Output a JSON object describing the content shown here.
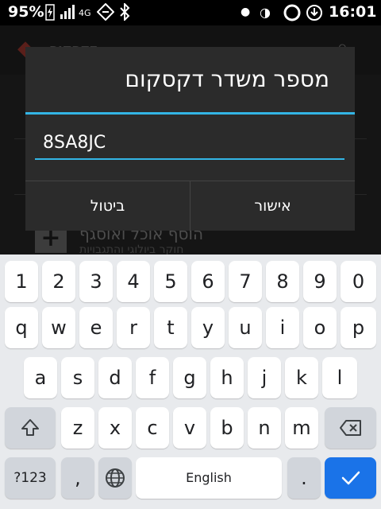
{
  "status_bar": {
    "battery": "95%",
    "network": "4G",
    "time": "16:01"
  },
  "dialog": {
    "title": "מספר משדר דקסקום",
    "input_value": "8SA8JC",
    "cancel_label": "ביטול",
    "ok_label": "אישור"
  },
  "background": {
    "app_title": "דקסקום",
    "item_title": "הוסף אוכל ואוסגף",
    "item_subtitle": "חוקר ביולוגי והתגבויות"
  },
  "keyboard": {
    "row_numbers": [
      "1",
      "2",
      "3",
      "4",
      "5",
      "6",
      "7",
      "8",
      "9",
      "0"
    ],
    "row_q": [
      "q",
      "w",
      "e",
      "r",
      "t",
      "y",
      "u",
      "i",
      "o",
      "p"
    ],
    "row_a": [
      "a",
      "s",
      "d",
      "f",
      "g",
      "h",
      "j",
      "k",
      "l"
    ],
    "row_z": [
      "z",
      "x",
      "c",
      "v",
      "b",
      "n",
      "m"
    ],
    "symbols_label": "?123",
    "comma_label": ",",
    "space_label": "English",
    "period_label": ".",
    "accent_color": "#1a73e8"
  }
}
